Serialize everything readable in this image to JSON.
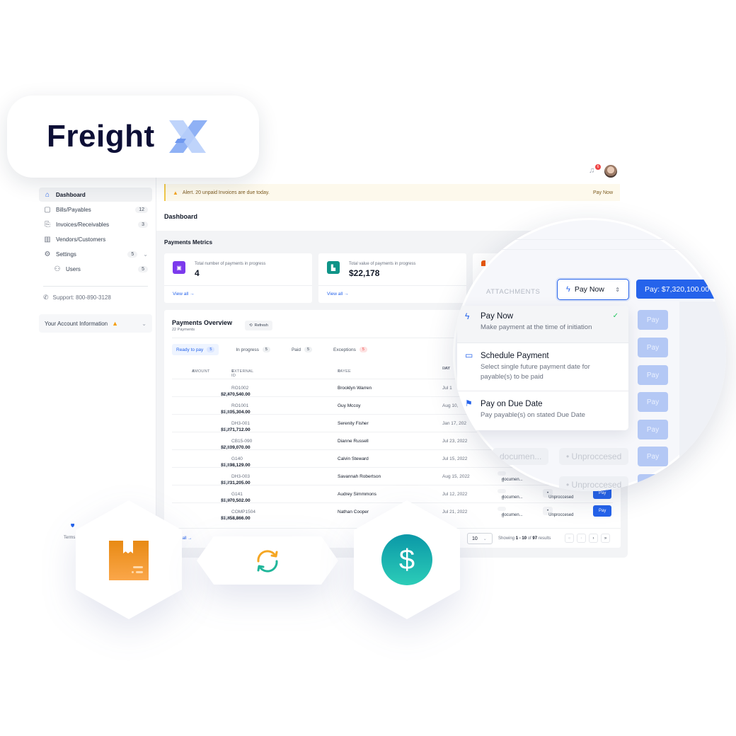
{
  "brand": {
    "name": "Freight",
    "logo_mark": "x-mark-icon",
    "colors": {
      "text": "#0d0f36",
      "mark": "#8fb1f5",
      "accent": "#2563eb"
    }
  },
  "sidebar": {
    "items": [
      {
        "label": "Dashboard",
        "icon": "home-icon",
        "active": true
      },
      {
        "label": "Bills/Payables",
        "icon": "bills-icon",
        "badge": "12"
      },
      {
        "label": "Invoices/Receivables",
        "icon": "invoice-icon",
        "badge": "3"
      },
      {
        "label": "Vendors/Customers",
        "icon": "building-icon"
      },
      {
        "label": "Settings",
        "icon": "gear-icon",
        "badge": "5",
        "expandable": true
      },
      {
        "label": "Users",
        "icon": "users-icon",
        "badge": "5",
        "sub": true
      }
    ],
    "support": "Support: 800-890-3128",
    "account": "Your Account Information",
    "footer_terms": "Terms"
  },
  "header": {
    "notifications_count": "6"
  },
  "alert": {
    "text": "Alert. 20 unpaid Invoices are due today.",
    "action": "Pay Now"
  },
  "page": {
    "title": "Dashboard"
  },
  "metrics": {
    "title": "Payments Metrics",
    "cards": [
      {
        "label": "Total number of payments in progress",
        "value": "4",
        "link": "View all",
        "color": "#7c3aed"
      },
      {
        "label": "Total value of payments in progress",
        "value": "$22,178",
        "link": "View all",
        "color": "#0f9488"
      }
    ]
  },
  "overview": {
    "title": "Payments Overview",
    "subtitle": "22 Payments",
    "refresh": "Refresh",
    "tabs": [
      {
        "label": "Ready to pay",
        "count": "5",
        "active": true
      },
      {
        "label": "In progress",
        "count": "5"
      },
      {
        "label": "Paid",
        "count": "5"
      },
      {
        "label": "Exceptions",
        "count": "5",
        "danger": true
      }
    ],
    "columns": {
      "amount": "AMOUNT",
      "external_id": "EXTERNAL ID",
      "payee": "PAYEE",
      "pay_date_1": "PAY",
      "pay_date_2": "DAT"
    },
    "rows": [
      {
        "amount": "$2,470,540.00",
        "currency": "USD",
        "external_id": "RO1002",
        "payee": "Brooklyn Warren",
        "date": "Jul 1"
      },
      {
        "amount": "$1,105,304.00",
        "currency": "USD",
        "external_id": "RO1001",
        "payee": "Guy Mccoy",
        "date": "Aug 10,"
      },
      {
        "amount": "$1,271,712.00",
        "currency": "USD",
        "external_id": "DH3-001",
        "payee": "Serenity Fisher",
        "date": "Jan 17, 202"
      },
      {
        "amount": "$2,109,070.00",
        "currency": "USD",
        "external_id": "CB15-090",
        "payee": "Dianne Russell",
        "date": "Jul 23, 2022"
      },
      {
        "amount": "$1,198,129.00",
        "currency": "USD",
        "external_id": "G140",
        "payee": "Calvin Steward",
        "date": "Jul 15, 2022"
      },
      {
        "amount": "$1,731,205.00",
        "currency": "USD",
        "external_id": "DH3-003",
        "payee": "Savannah Robertson",
        "date": "Aug 15, 2022",
        "attachment": "documen..."
      },
      {
        "amount": "$1,970,502.00",
        "currency": "USD",
        "external_id": "G141",
        "payee": "Audrey Simmmons",
        "date": "Jul 12, 2022",
        "attachment": "documen...",
        "status": "Unproccesed",
        "action": "Pay"
      },
      {
        "amount": "$1,858,866.00",
        "currency": "USD",
        "external_id": "COMP1504",
        "payee": "Nathan Cooper",
        "date": "Jul 21, 2022",
        "attachment": "documen...",
        "status": "Unproccesed",
        "action": "Pay"
      }
    ],
    "footer": {
      "view_all": "View all",
      "per_page_label": "e:",
      "per_page": "10",
      "showing_prefix": "Showing",
      "showing_range": "1 - 10",
      "showing_of": "of",
      "showing_total": "97",
      "showing_suffix": "results",
      "pager": [
        "«",
        "‹",
        "›",
        "»"
      ]
    }
  },
  "magnifier": {
    "attachments_label": "ATTACHMENTS",
    "select_value": "Pay Now",
    "pay_total": "Pay: $7,320,100.00",
    "pay_label": "Pay",
    "ghost_attachment": "documen...",
    "ghost_status": "Unproccesed",
    "options": [
      {
        "title": "Pay Now",
        "desc": "Make payment at the time of initiation",
        "icon": "bolt-icon",
        "selected": true
      },
      {
        "title": "Schedule Payment",
        "desc": "Select single future payment date for payable(s) to be paid",
        "icon": "calendar-icon"
      },
      {
        "title": "Pay on Due Date",
        "desc": "Pay payable(s) on stated Due Date",
        "icon": "flag-icon"
      }
    ]
  },
  "feature_icons": [
    {
      "name": "package-icon",
      "color": "#f29a2e"
    },
    {
      "name": "sync-icon",
      "color": "#f5a623"
    },
    {
      "name": "dollar-coin-icon",
      "color": "#14b8a6",
      "glyph": "$"
    }
  ]
}
